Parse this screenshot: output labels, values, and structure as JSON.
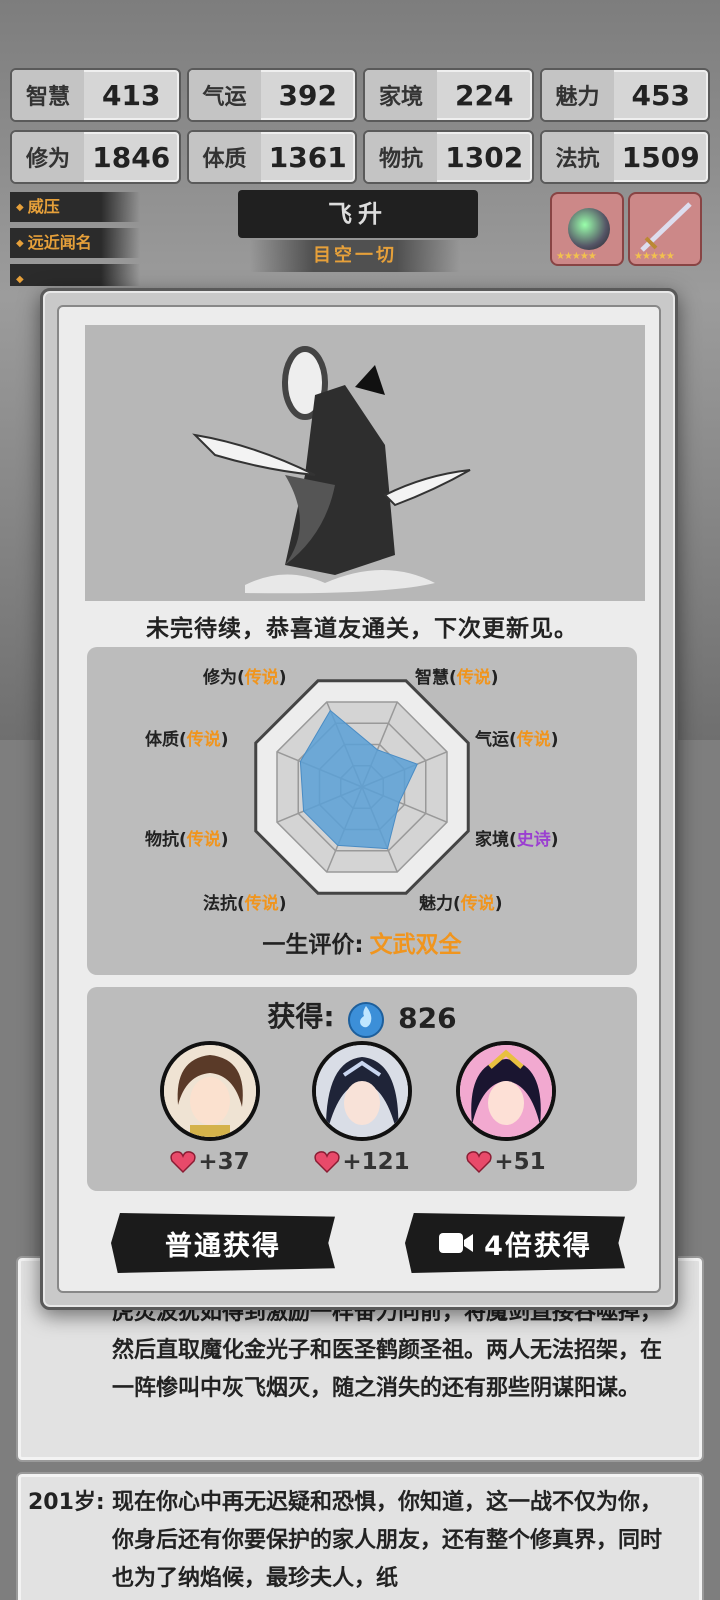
{
  "stats": [
    {
      "label": "智慧",
      "value": "413"
    },
    {
      "label": "气运",
      "value": "392"
    },
    {
      "label": "家境",
      "value": "224"
    },
    {
      "label": "魅力",
      "value": "453"
    },
    {
      "label": "修为",
      "value": "1846"
    },
    {
      "label": "体质",
      "value": "1361"
    },
    {
      "label": "物抗",
      "value": "1302"
    },
    {
      "label": "法抗",
      "value": "1509"
    }
  ],
  "tags": [
    "威压",
    "远近闻名"
  ],
  "realm": {
    "title": "飞升",
    "subtitle": "目空一切"
  },
  "modal": {
    "completion_text": "未完待续，恭喜道友通关，下次更新见。",
    "radar": {
      "axes": [
        {
          "name": "智慧",
          "grade": "传说",
          "value": 0.35
        },
        {
          "name": "气运",
          "grade": "传说",
          "value": 0.52
        },
        {
          "name": "家境",
          "grade": "史诗",
          "value": 0.35
        },
        {
          "name": "魅力",
          "grade": "传说",
          "value": 0.58
        },
        {
          "name": "法抗",
          "grade": "传说",
          "value": 0.55
        },
        {
          "name": "物抗",
          "grade": "传说",
          "value": 0.55
        },
        {
          "name": "体质",
          "grade": "传说",
          "value": 0.58
        },
        {
          "name": "修为",
          "grade": "传说",
          "value": 0.72
        }
      ],
      "paren_open": "(",
      "paren_close": ")"
    },
    "evaluation": {
      "label": "一生评价:",
      "value": "文武双全"
    },
    "reward": {
      "label": "获得:",
      "amount": "826",
      "characters": [
        {
          "affinity": "+37"
        },
        {
          "affinity": "+121"
        },
        {
          "affinity": "+51"
        }
      ]
    },
    "buttons": {
      "normal": "普通获得",
      "video": "4倍获得"
    }
  },
  "log": [
    {
      "age": "",
      "text": "虎灵波犹如得到激励一样奋力向前，将魔剑直接吞噬掉，然后直取魔化金光子和医圣鹤颜圣祖。两人无法招架，在一阵惨叫中灰飞烟灭，随之消失的还有那些阴谋阳谋。"
    },
    {
      "age": "201岁:",
      "text": "现在你心中再无迟疑和恐惧，你知道，这一战不仅为你，你身后还有你要保护的家人朋友，还有整个修真界，同时也为了纳焰候，最珍夫人，纸"
    }
  ],
  "colors": {
    "legend_orange": "#f0951e",
    "epic_purple": "#9b3fd1",
    "radar_fill": "#5aa0d6"
  }
}
